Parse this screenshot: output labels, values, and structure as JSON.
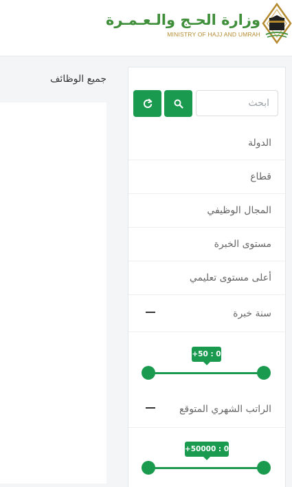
{
  "header": {
    "logo_ar": "وزارة الحـج والـعـمـرة",
    "logo_en": "MINISTRY OF HAJJ AND UMRAH"
  },
  "main": {
    "all_jobs_label": "جميع الوظائف"
  },
  "sidebar": {
    "search": {
      "placeholder": "ابحث"
    },
    "filters": [
      {
        "label": "الدولة"
      },
      {
        "label": "قطاع"
      },
      {
        "label": "المجال الوظيفي"
      },
      {
        "label": "مستوى الخبرة"
      },
      {
        "label": "أعلى مستوى تعليمي"
      }
    ],
    "experience": {
      "label": "سنة خبرة",
      "badge": "+50 : 0",
      "min": 0,
      "max": 50
    },
    "salary": {
      "label": "الراتب الشهري المتوقع",
      "badge": "+50000 : 0",
      "min": 0,
      "max": 50000
    }
  },
  "colors": {
    "accent": "#199a4f",
    "logo_green": "#3f8e3a",
    "logo_gold": "#b58a2e",
    "background": "#f3f5f7"
  }
}
